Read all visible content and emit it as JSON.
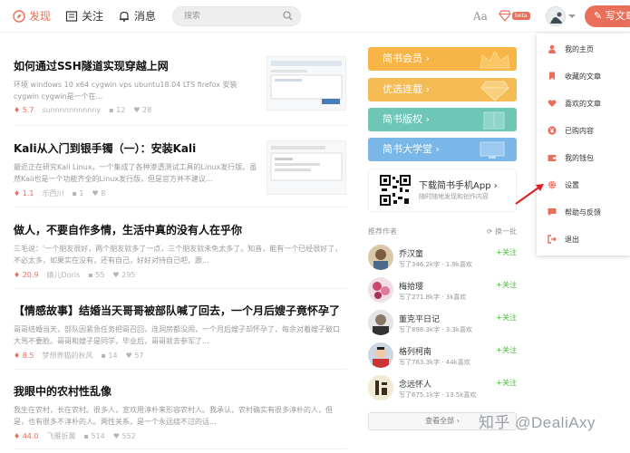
{
  "nav": {
    "discover": "发现",
    "follow": "关注",
    "messages": "消息",
    "search_placeholder": "搜索",
    "aa": "Aa",
    "beta": "beta",
    "write": "写文章"
  },
  "articles": [
    {
      "title": "如何通过SSH隧道实现穿越上网",
      "abstract": "环境 windows 10 x64 cygwin vps ubuntu18.04 LTS firefox 安装cygwin cygwin是一个在...",
      "score": "5.7",
      "author": "sunnnnnnnnnny",
      "comments": "12",
      "likes": "28"
    },
    {
      "title": "Kali从入门到银手镯（一）：安装Kali",
      "abstract": "最近正在研究Kali Linux。一个集成了各种渗透测试工具的Linux发行版。虽然Kali也是一个功能齐全的Linux发行版，但是官方并不建议...",
      "score": "1.1",
      "author": "乐西川",
      "comments": "1",
      "likes": "8"
    },
    {
      "title": "做人，不要自作多情，生活中真的没有人在乎你",
      "abstract": "三毛说：'一个朋友很好，两个朋友就多了一点，三个朋友就未免太多了。知音，能有一个已经很好了，不必太多，如果实在没有，还有自己，好好对待自己吧，跟...",
      "score": "20.9",
      "author": "婧儿Doris",
      "comments": "55",
      "likes": "295"
    },
    {
      "title": "【情感故事】结婚当天哥哥被部队喊了回去，一个月后嫂子竟怀孕了",
      "abstract": "哥哥结婚当天，部队因紧急任务把哥召回，连洞房都没闹，一个月后嫂子却怀孕了，每余对着嫂子破口大骂不要脸。哥哥和嫂子是同学，毕业后，哥哥就去参军了...",
      "score": "8.5",
      "author": "梦想养猫的秋风",
      "comments": "14",
      "likes": "57"
    },
    {
      "title": "我眼中的农村性乱像",
      "abstract": "我生在农村，长在农村。很多人，宣欢用淳朴来形容农村人。我承认，农村确实有很多淳朴的人，但是，也有很多不淳朴的人。两性关系，是一个永远绕不过的话...",
      "score": "44.0",
      "author": "飞雁折翼",
      "comments": "514",
      "likes": "552"
    }
  ],
  "sidebar": {
    "banners": [
      "简书会员",
      "优选连载",
      "简书版权",
      "简书大学堂"
    ],
    "app_title": "下载简书手机App",
    "app_sub": "随时随地发现和创作内容",
    "recommend_title": "推荐作者",
    "swap": "换一批",
    "authors": [
      {
        "name": "乔汉童",
        "info": "写了346.2k字 · 1.9k喜欢",
        "follow": "+关注"
      },
      {
        "name": "梅拾璎",
        "info": "写了271.8k字 · 3k喜欢",
        "follow": "+关注"
      },
      {
        "name": "董克平日记",
        "info": "写了898.3k字 · 3.3k喜欢",
        "follow": "+关注"
      },
      {
        "name": "格列柯南",
        "info": "写了763.3k字 · 44k喜欢",
        "follow": "+关注"
      },
      {
        "name": "念远怀人",
        "info": "写了675.1k字 · 13.5k喜欢",
        "follow": "+关注"
      }
    ],
    "see_all": "查看全部"
  },
  "menu": [
    "我的主页",
    "收藏的文章",
    "喜欢的文章",
    "已购内容",
    "我的钱包",
    "设置",
    "帮助与反馈",
    "退出"
  ],
  "watermark": "知乎 @DealiAxy",
  "colors": {
    "accent": "#ea6f5a",
    "follow": "#42c02e"
  }
}
